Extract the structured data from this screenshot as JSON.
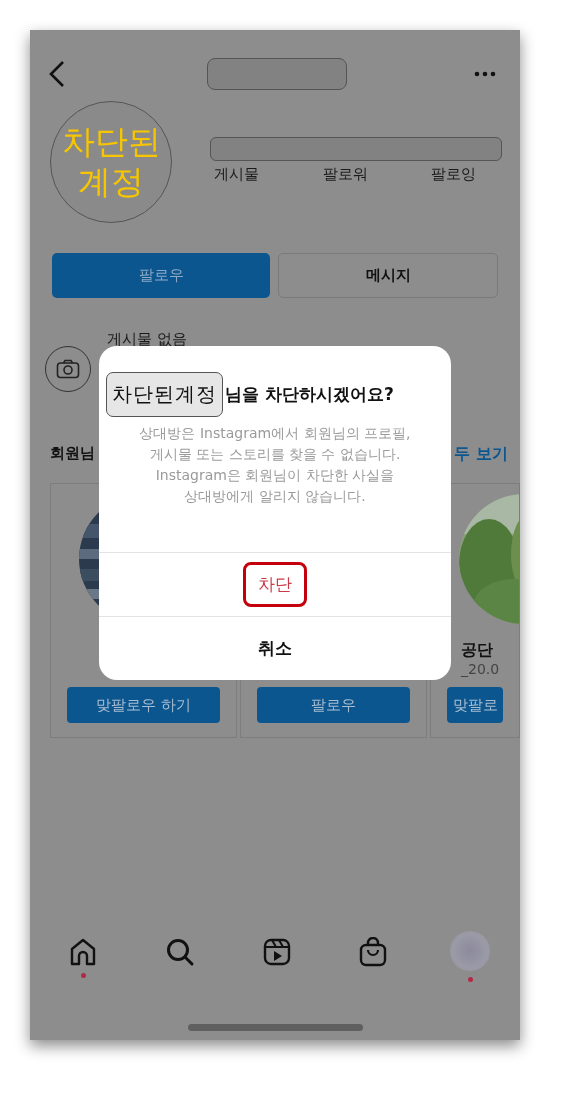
{
  "header": {
    "username_redacted": true
  },
  "profile": {
    "avatar_text": "차단된 계정",
    "stats_redacted": true,
    "stats": [
      "게시물",
      "팔로워",
      "팔로잉"
    ]
  },
  "actions": [
    {
      "label": "팔로우",
      "kind": "primary"
    },
    {
      "label": "메시지",
      "kind": "secondary"
    }
  ],
  "posts_empty": "게시물 없음",
  "suggestions": {
    "title": "회원님",
    "see_all": "두 보기",
    "cards": [
      {
        "photo": true,
        "button": "맞팔로우 하기"
      },
      {
        "photo": false,
        "button": "팔로우"
      },
      {
        "photo": true,
        "name": "공단",
        "sub": "_20.0",
        "button": "맞팔로"
      }
    ]
  },
  "dialog": {
    "title_tag": "차단된계정",
    "title": "님을 차단하시겠어요?",
    "message": "상대방은 Instagram에서 회원님의 프로필,\n게시물 또는 스토리를 찾을 수 없습니다.\nInstagram은 회원님이 차단한 사실을\n상대방에게 알리지 않습니다.",
    "buttons": [
      {
        "label": "차단",
        "kind": "destructive",
        "highlighted": true
      },
      {
        "label": "취소",
        "kind": "default",
        "highlighted": false
      }
    ]
  },
  "nav": [
    {
      "kind": "home",
      "dot": true
    },
    {
      "kind": "search",
      "dot": false
    },
    {
      "kind": "reels",
      "dot": false
    },
    {
      "kind": "shop",
      "dot": false
    },
    {
      "kind": "profile",
      "dot": true
    }
  ]
}
